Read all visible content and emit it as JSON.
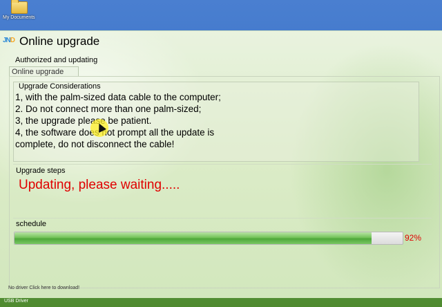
{
  "desktop": {
    "icon_label": "My Documents",
    "taskbar_label": "USB Driver"
  },
  "window": {
    "logo_text_a": "JN",
    "logo_text_b": "D",
    "title": "Online upgrade"
  },
  "status": {
    "authorized_label": "Authorized and updating"
  },
  "tabs": [
    {
      "label": "Online upgrade"
    }
  ],
  "considerations": {
    "title": "Upgrade Considerations",
    "lines": [
      "1, with the palm-sized data cable to the computer;",
      "2. Do not connect more than one palm-sized;",
      "3, the upgrade please be patient.",
      "4, the software does not prompt all the update is",
      "complete, do not disconnect the cable!"
    ]
  },
  "steps": {
    "title": "Upgrade steps",
    "message": "Updating, please waiting....."
  },
  "schedule": {
    "title": "schedule",
    "progress": 0.92,
    "percent_text": "92%"
  },
  "footer": {
    "driver_link": "No driver Click here to download!"
  },
  "colors": {
    "accent_red": "#e00000",
    "progress_green": "#4ea83a"
  }
}
